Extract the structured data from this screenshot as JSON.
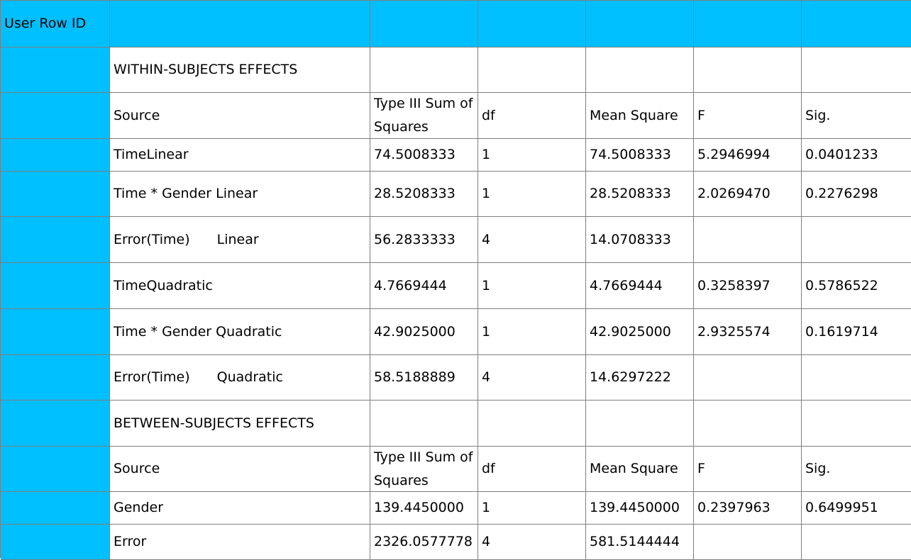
{
  "header": {
    "row_id_label": "User Row ID"
  },
  "sections": {
    "within_title": "WITHIN-SUBJECTS EFFECTS",
    "between_title": "BETWEEN-SUBJECTS EFFECTS"
  },
  "columns": {
    "source": "Source",
    "ss": "Type III Sum of Squares",
    "df": "df",
    "ms": "Mean Square",
    "f": "F",
    "sig": "Sig."
  },
  "within_rows": [
    {
      "source": "TimeLinear",
      "ss": "74.5008333",
      "df": "1",
      "ms": "74.5008333",
      "f": "5.2946994",
      "sig": "0.0401233"
    },
    {
      "source": "Time * Gender Linear",
      "ss": "28.5208333",
      "df": "1",
      "ms": "28.5208333",
      "f": "2.0269470",
      "sig": "0.2276298"
    },
    {
      "source_a": "Error(Time)",
      "source_b": "Linear",
      "ss": "56.2833333",
      "df": "4",
      "ms": "14.0708333",
      "f": "",
      "sig": ""
    },
    {
      "source": "TimeQuadratic",
      "ss": "4.7669444",
      "df": "1",
      "ms": "4.7669444",
      "f": "0.3258397",
      "sig": "0.5786522"
    },
    {
      "source": "Time * Gender Quadratic",
      "ss": "42.9025000",
      "df": "1",
      "ms": "42.9025000",
      "f": "2.9325574",
      "sig": "0.1619714"
    },
    {
      "source_a": "Error(Time)",
      "source_b": "Quadratic",
      "ss": "58.5188889",
      "df": "4",
      "ms": "14.6297222",
      "f": "",
      "sig": ""
    }
  ],
  "between_rows": [
    {
      "source": "Gender",
      "ss": "139.4450000",
      "df": "1",
      "ms": "139.4450000",
      "f": "0.2397963",
      "sig": "0.6499951"
    },
    {
      "source": "Error",
      "ss": "2326.0577778",
      "df": "4",
      "ms": "581.5144444",
      "f": "",
      "sig": ""
    }
  ],
  "colors": {
    "header_bg": "#00bfff",
    "grid_line": "#7f7f7f"
  }
}
